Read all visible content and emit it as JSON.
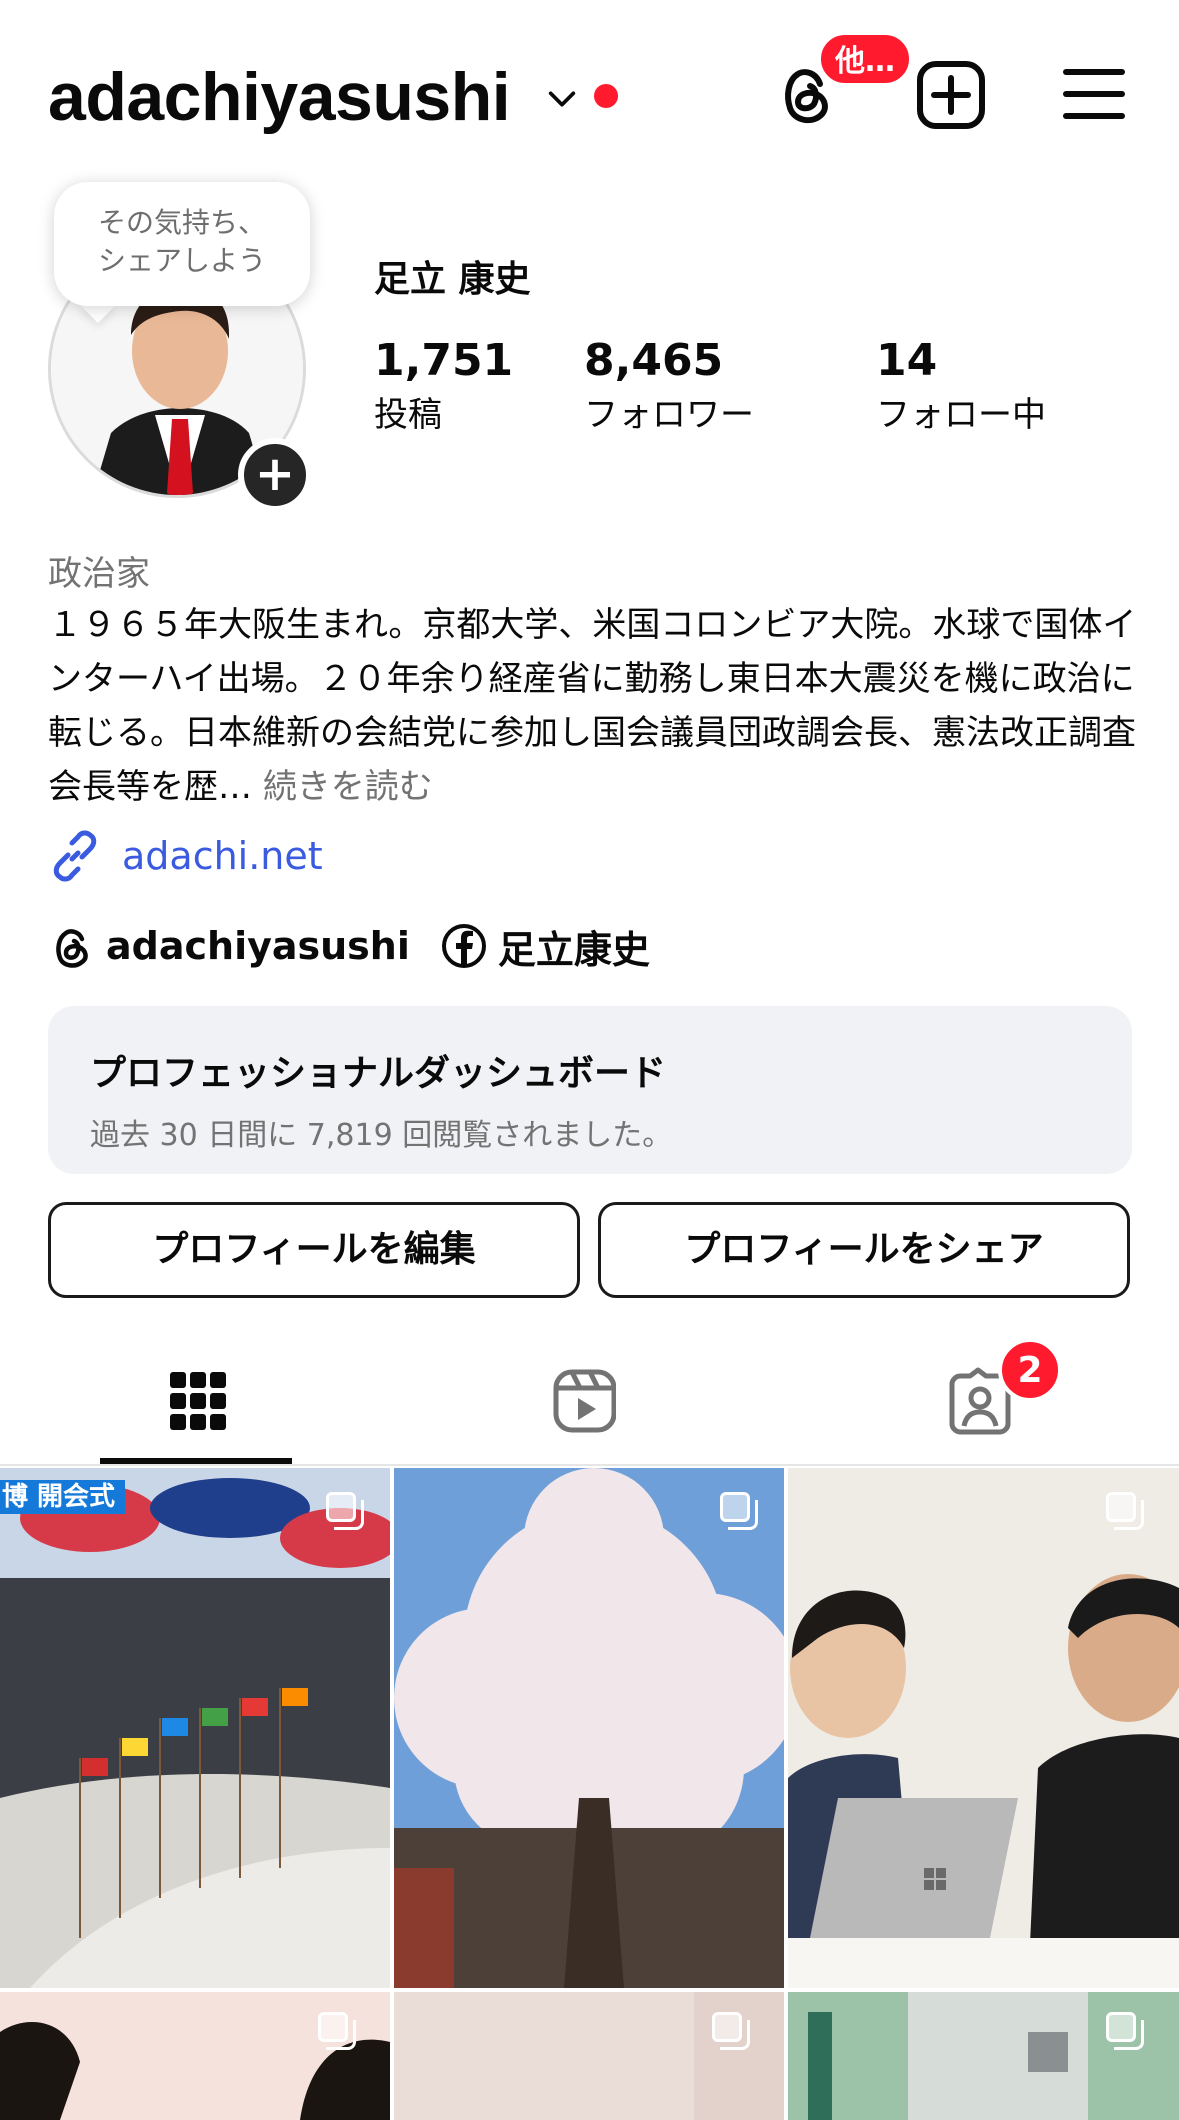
{
  "header": {
    "username": "adachiyasushi",
    "threads_badge": "他…"
  },
  "profile": {
    "note_bubble": [
      "その気持ち、",
      "シェアしよう"
    ],
    "full_name": "足立 康史",
    "stats": [
      {
        "value": "1,751",
        "label": "投稿"
      },
      {
        "value": "8,465",
        "label": "フォロワー"
      },
      {
        "value": "14",
        "label": "フォロー中"
      }
    ],
    "category": "政治家",
    "bio": "１９６５年大阪生まれ。京都大学、米国コロンビア大院。水球で国体インターハイ出場。２０年余り経産省に勤務し東日本大震災を機に政治に転じる。日本維新の会結党に参加し国会議員団政調会長、憲法改正調査会長等を歴…",
    "bio_more": "続きを読む",
    "link": "adachi.net",
    "threads_handle": "adachiyasushi",
    "facebook_name": "足立康史"
  },
  "dashboard": {
    "title": "プロフェッショナルダッシュボード",
    "subtitle": "過去 30 日間に 7,819 回閲覧されました。"
  },
  "buttons": {
    "edit_profile": "プロフィールを編集",
    "share_profile": "プロフィールをシェア"
  },
  "tabs": {
    "tagged_badge": "2"
  },
  "grid": {
    "first_post_banner": "博 開会式"
  },
  "colors": {
    "accent_red": "#ff1a2e",
    "link_blue": "#3a5ae0",
    "muted_text": "#737373"
  }
}
